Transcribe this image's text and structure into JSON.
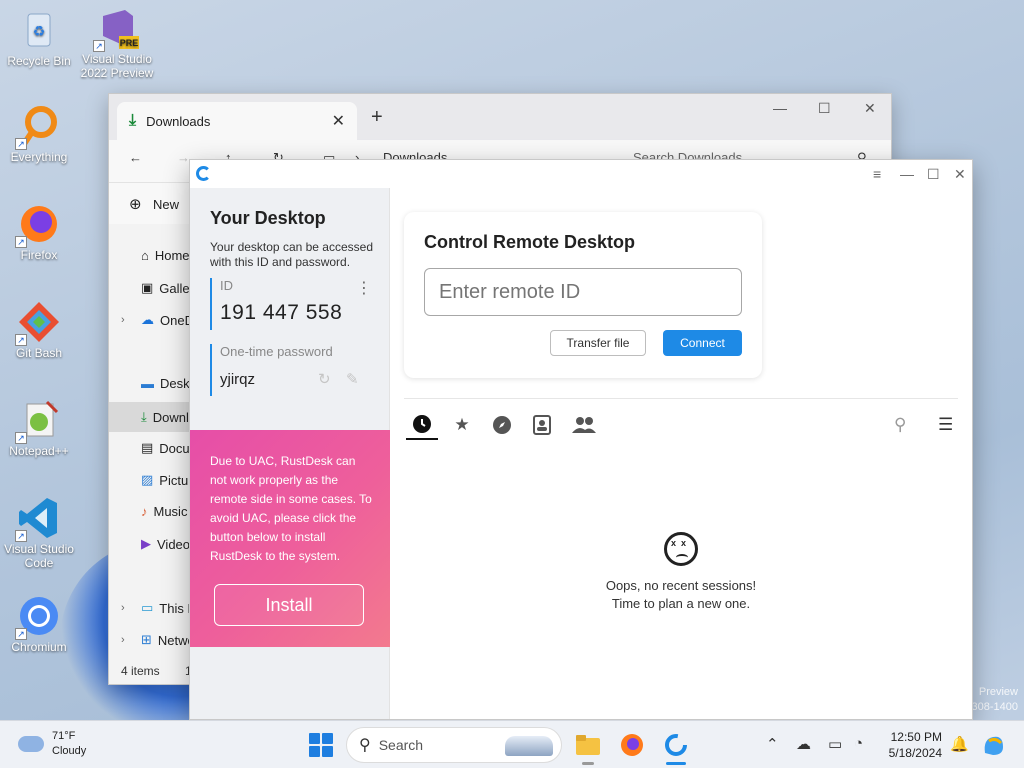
{
  "desktop": {
    "icons": [
      {
        "label": "Recycle Bin",
        "icon": "recycle-bin-icon"
      },
      {
        "label": "Visual Studio 2022 Preview",
        "icon": "visual-studio-icon",
        "badge": "PRE"
      },
      {
        "label": "Everything",
        "icon": "everything-search-icon"
      },
      {
        "label": "Firefox",
        "icon": "firefox-icon"
      },
      {
        "label": "Git Bash",
        "icon": "git-bash-icon"
      },
      {
        "label": "Notepad++",
        "icon": "notepad-plus-plus-icon"
      },
      {
        "label": "Visual Studio Code",
        "icon": "vscode-icon"
      },
      {
        "label": "Chromium",
        "icon": "chromium-icon"
      }
    ],
    "watermark_line1": "Preview",
    "watermark_line2": "308-1400"
  },
  "explorer": {
    "tab_title": "Downloads",
    "address": "Downloads",
    "search_placeholder": "Search Downloads",
    "new_label": "New",
    "sidebar": [
      {
        "label": "Home"
      },
      {
        "label": "Gallery"
      },
      {
        "label": "OneDrive"
      },
      {
        "label": "Desktop"
      },
      {
        "label": "Downloads"
      },
      {
        "label": "Documents"
      },
      {
        "label": "Pictures"
      },
      {
        "label": "Music"
      },
      {
        "label": "Videos"
      },
      {
        "label": "This PC"
      },
      {
        "label": "Network"
      }
    ],
    "status": "4 items",
    "status_extra": "1"
  },
  "rustdesk": {
    "your_desktop_title": "Your Desktop",
    "your_desktop_desc": "Your desktop can be accessed with this ID and password.",
    "id_label": "ID",
    "id_value": "191 447 558",
    "password_label": "One-time password",
    "password_value": "yjirqz",
    "uac_message": "Due to UAC, RustDesk can not work properly as the remote side in some cases. To avoid UAC, please click the button below to install RustDesk to the system.",
    "install_label": "Install",
    "control_title": "Control Remote Desktop",
    "remote_id_placeholder": "Enter remote ID",
    "transfer_file_label": "Transfer file",
    "connect_label": "Connect",
    "tabs": [
      "recent-sessions",
      "favorites",
      "discovered",
      "address-book",
      "group"
    ],
    "empty_line1": "Oops, no recent sessions!",
    "empty_line2": "Time to plan a new one.",
    "accent_color": "#1e8ae6"
  },
  "taskbar": {
    "weather_temp": "71°F",
    "weather_desc": "Cloudy",
    "search_label": "Search",
    "time": "12:50 PM",
    "date": "5/18/2024"
  }
}
